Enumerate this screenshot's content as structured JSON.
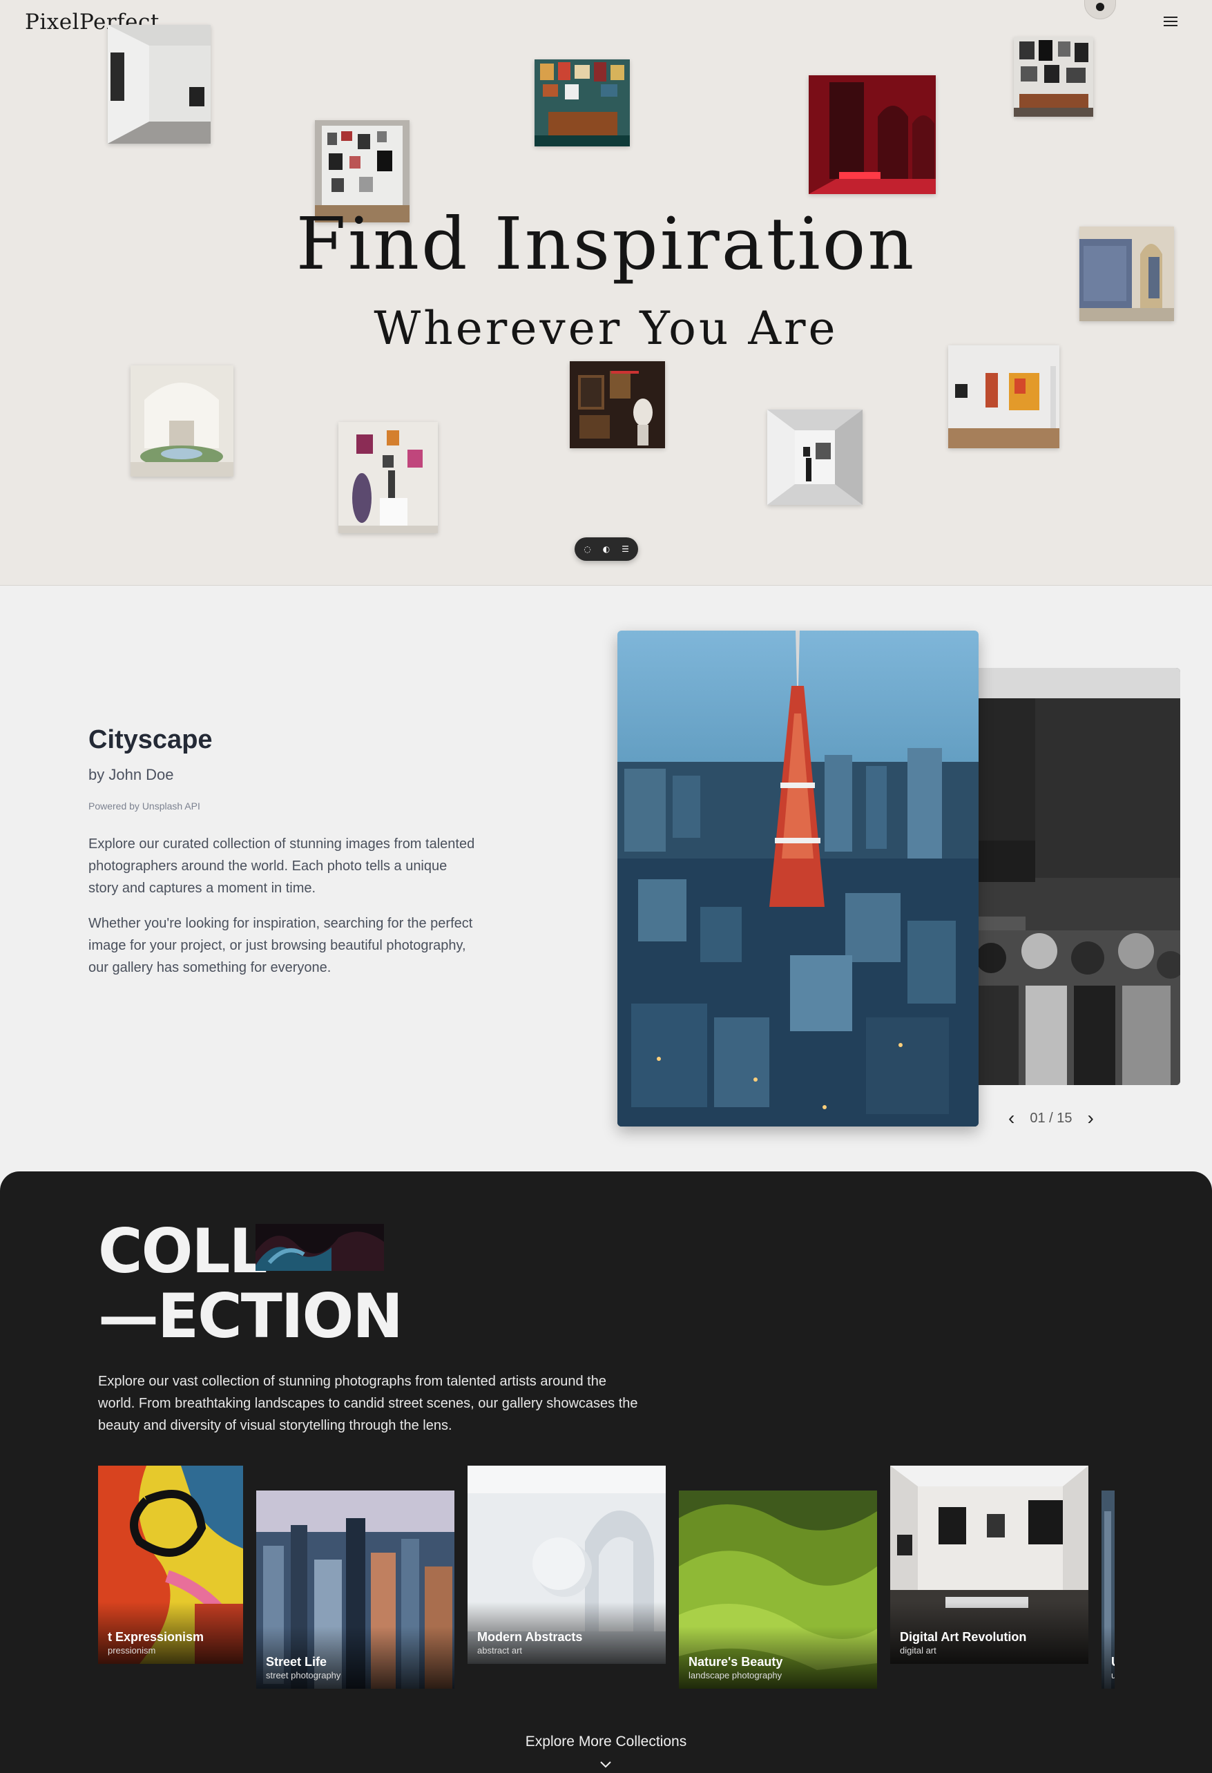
{
  "brand": {
    "logo": "PixelPerfect"
  },
  "hero": {
    "title": "Find Inspiration",
    "subtitle": "Wherever You Are",
    "pill_icons": [
      "chat-icon",
      "toggle-icon",
      "list-icon"
    ]
  },
  "featured": {
    "title": "Cityscape",
    "author": "by John Doe",
    "powered": "Powered by Unsplash API",
    "paragraph1": "Explore our curated collection of stunning images from talented photographers around the world. Each photo tells a unique story and captures a moment in time.",
    "paragraph2": "Whether you're looking for inspiration, searching for the perfect image for your project, or just browsing beautiful photography, our gallery has something for everyone.",
    "counter": "01 / 15"
  },
  "collection": {
    "word1": "COLL",
    "word2": "—ECTION",
    "description": "Explore our vast collection of stunning photographs from talented artists around the world. From breathtaking landscapes to candid street scenes, our gallery showcases the beauty and diversity of visual storytelling through the lens.",
    "cards": [
      {
        "name": "t Expressionism",
        "tag": "pressionism"
      },
      {
        "name": "Street Life",
        "tag": "street photography"
      },
      {
        "name": "Modern Abstracts",
        "tag": "abstract art"
      },
      {
        "name": "Nature's Beauty",
        "tag": "landscape photography"
      },
      {
        "name": "Digital Art Revolution",
        "tag": "digital art"
      },
      {
        "name": "U",
        "tag": "u"
      }
    ],
    "explore_label": "Explore More Collections"
  },
  "colors": {
    "hero_bg": "#ebe8e4",
    "feature_bg": "#f0f0f0",
    "collection_bg": "#1c1c1c",
    "title_ink": "#151515"
  }
}
